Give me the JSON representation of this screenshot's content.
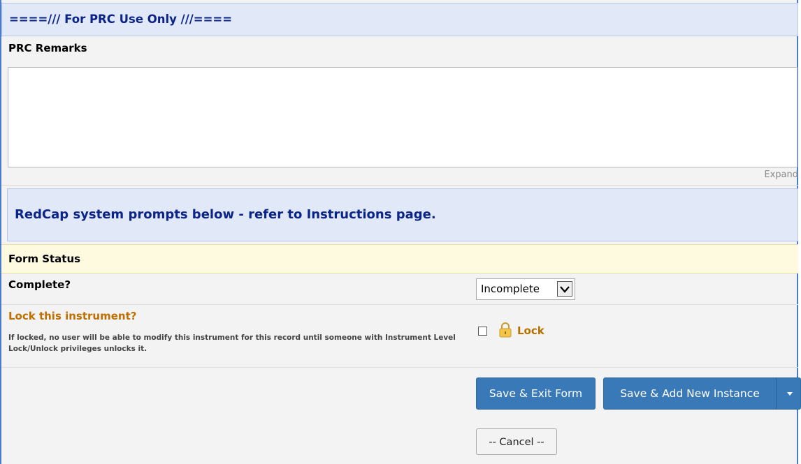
{
  "header": {
    "title": "====/// For PRC Use Only  ///===="
  },
  "remarks": {
    "label": "PRC Remarks",
    "value": "",
    "expand_label": "Expand"
  },
  "notice": {
    "text": "RedCap system prompts below - refer to Instructions page."
  },
  "form_status": {
    "section_title": "Form Status",
    "complete_label": "Complete?",
    "complete_value": "Incomplete"
  },
  "lock": {
    "label": "Lock this instrument?",
    "note": "If locked, no user will be able to modify this instrument for this record until someone with Instrument Level Lock/Unlock privileges unlocks it.",
    "checkbox_label": "Lock",
    "checked": false
  },
  "buttons": {
    "save_exit": "Save & Exit Form",
    "save_add": "Save & Add New Instance",
    "cancel": "-- Cancel --"
  },
  "icons": {
    "dropdown": "chevron-down-icon",
    "lock": "padlock-icon",
    "caret": "caret-down-icon"
  },
  "colors": {
    "header_bg": "#e1e8f8",
    "header_text": "#0b2488",
    "form_status_bg": "#fefae0",
    "lock_label": "#c07000",
    "primary_button": "#3a79b8"
  }
}
